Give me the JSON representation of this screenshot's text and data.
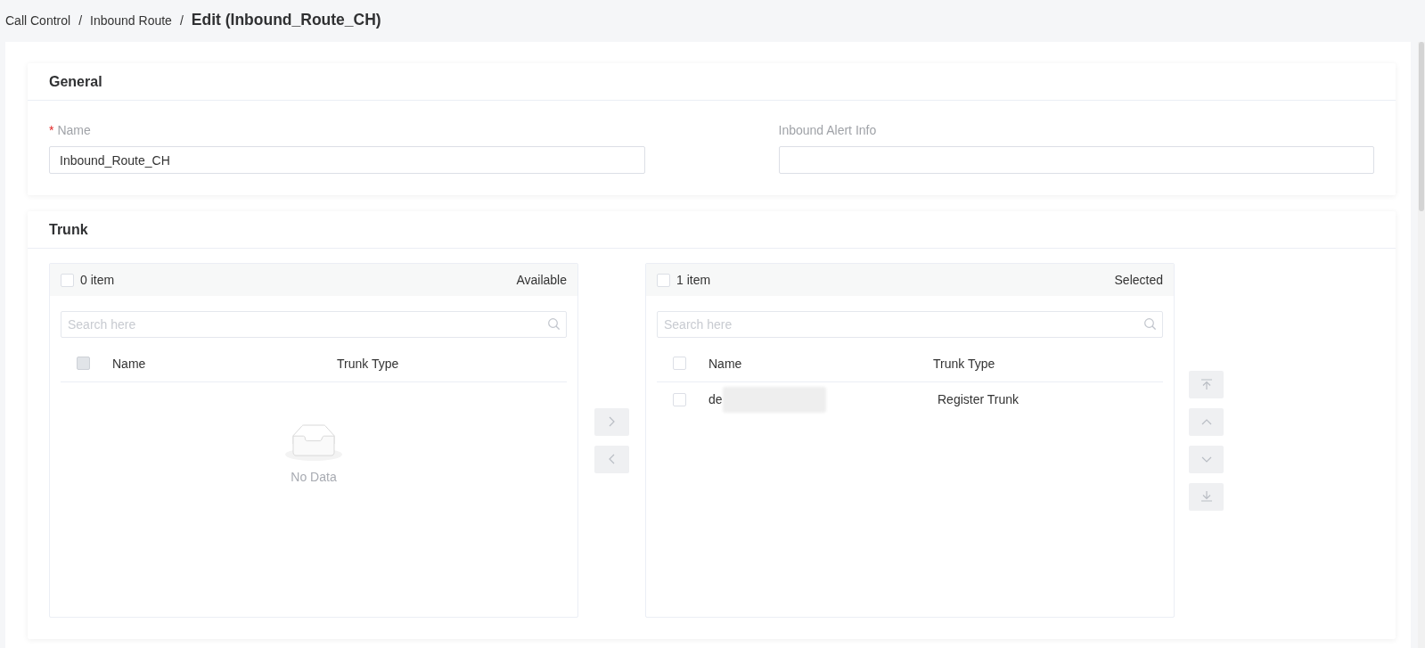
{
  "breadcrumb": [
    {
      "kind": "link",
      "text": "Call Control"
    },
    {
      "kind": "separator",
      "text": "/"
    },
    {
      "kind": "link",
      "text": "Inbound Route"
    },
    {
      "kind": "separator",
      "text": "/"
    },
    {
      "kind": "current",
      "text": "Edit (Inbound_Route_CH)"
    }
  ],
  "general": {
    "title": "General",
    "fields": [
      {
        "label": "Name",
        "required_mark": "*",
        "value": "Inbound_Route_CH"
      },
      {
        "label": "Inbound Alert Info"
      }
    ]
  },
  "trunk": {
    "title": "Trunk",
    "lists": [
      {
        "count": "0 item",
        "title": "Available",
        "checked": false,
        "search": {
          "placeholder": "Search here"
        },
        "columns": [
          "Name",
          "Trunk Type"
        ],
        "header_checkbox": {
          "checked": false,
          "disabled": true
        },
        "empty_text": "No Data"
      },
      {
        "count": "1 item",
        "title": "Selected",
        "checked": false,
        "search": {
          "placeholder": "Search here"
        },
        "columns": [
          "Name",
          "Trunk Type"
        ],
        "header_checkbox": {
          "checked": false,
          "disabled": false
        },
        "rows": [
          {
            "name": "de",
            "redacted": true,
            "trunk_type": "Register Trunk",
            "checked": false
          }
        ]
      }
    ],
    "transfer_buttons": [
      {
        "kind": "right",
        "disabled": true
      },
      {
        "kind": "left",
        "disabled": true
      }
    ],
    "sort_buttons": [
      {
        "kind": "top",
        "disabled": true
      },
      {
        "kind": "up",
        "disabled": true
      },
      {
        "kind": "down",
        "disabled": true
      },
      {
        "kind": "bottom",
        "disabled": true
      }
    ]
  }
}
